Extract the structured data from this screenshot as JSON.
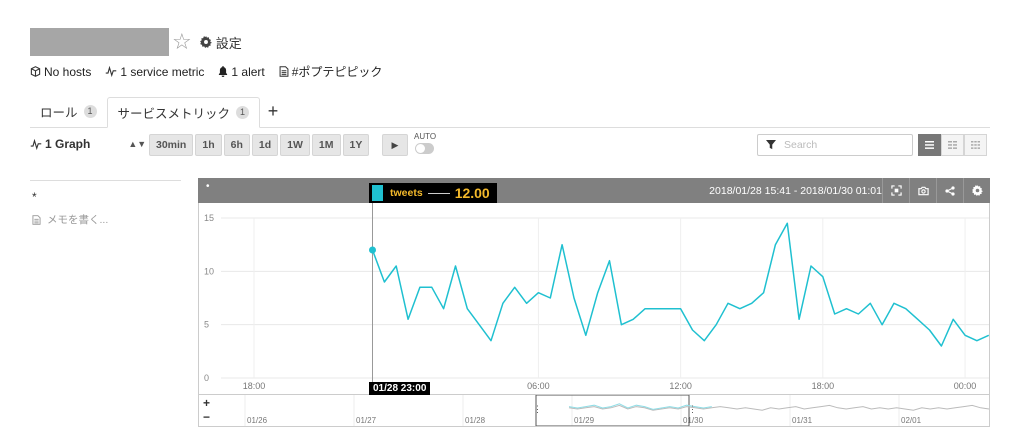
{
  "header": {
    "settings_label": "設定",
    "meta": {
      "hosts": "No hosts",
      "service_metric": "1 service metric",
      "alert": "1 alert",
      "tag": "#ポプテピピック"
    }
  },
  "tabs": [
    {
      "label": "ロール",
      "count": "1"
    },
    {
      "label": "サービスメトリック",
      "count": "1"
    }
  ],
  "tab_add": "+",
  "toolbar": {
    "graph_select": "1 Graph",
    "ranges": [
      "30min",
      "1h",
      "6h",
      "1d",
      "1W",
      "1M",
      "1Y"
    ],
    "auto_label": "AUTO",
    "search_placeholder": "Search"
  },
  "sidebar": {
    "asterisk": "*",
    "memo_placeholder": "メモを書く..."
  },
  "panel": {
    "date_range": "2018/01/28 15:41 - 2018/01/30 01:01"
  },
  "tooltip": {
    "series": "tweets",
    "value": "12.00",
    "time": "01/28 23:00"
  },
  "colors": {
    "series": "#1fc0d0",
    "tooltip_text": "#f3b92b",
    "panel_header": "#808080"
  },
  "chart_data": {
    "type": "line",
    "ylim": [
      0,
      15
    ],
    "y_ticks": [
      "0",
      "5",
      "10",
      "15"
    ],
    "x_tick_labels": [
      "18:00",
      "06:00",
      "12:00",
      "18:00",
      "00:00"
    ],
    "x_tick_hours": [
      2.32,
      14.32,
      20.32,
      26.32,
      32.32
    ],
    "x_range_hours": [
      0,
      33.33
    ],
    "series": [
      {
        "name": "tweets",
        "x_hours": [
          7.32,
          7.82,
          8.32,
          8.82,
          9.32,
          9.82,
          10.32,
          10.82,
          11.32,
          11.82,
          12.32,
          12.82,
          13.32,
          13.82,
          14.32,
          14.82,
          15.32,
          15.82,
          16.32,
          16.82,
          17.32,
          17.82,
          18.32,
          18.82,
          19.32,
          19.82,
          20.32,
          20.82,
          21.32,
          21.82,
          22.32,
          22.82,
          23.32,
          23.82,
          24.32,
          24.82,
          25.32,
          25.82,
          26.32,
          26.82,
          27.32,
          27.82,
          28.32,
          28.82,
          29.32,
          29.82,
          30.32,
          30.82,
          31.32,
          31.82,
          32.32,
          32.82,
          33.32
        ],
        "values": [
          12,
          9,
          10.5,
          5.5,
          8.5,
          8.5,
          6.5,
          10.5,
          6.5,
          5,
          3.5,
          7,
          8.5,
          7,
          8,
          7.5,
          12.5,
          7.5,
          4,
          8,
          11,
          5,
          5.5,
          6.5,
          6.5,
          6.5,
          6.5,
          4.5,
          3.5,
          5,
          7,
          6.5,
          7,
          8,
          12.5,
          14.5,
          5.5,
          10.5,
          9.5,
          6,
          6.5,
          6,
          7,
          5,
          7,
          6.5,
          5.5,
          4.5,
          3,
          5.5,
          4,
          3.5,
          4
        ]
      }
    ]
  },
  "navigator": {
    "plus": "+",
    "minus": "−",
    "date_labels": [
      "01/26",
      "01/27",
      "01/28",
      "01/29",
      "01/30",
      "01/31",
      "02/01"
    ]
  }
}
